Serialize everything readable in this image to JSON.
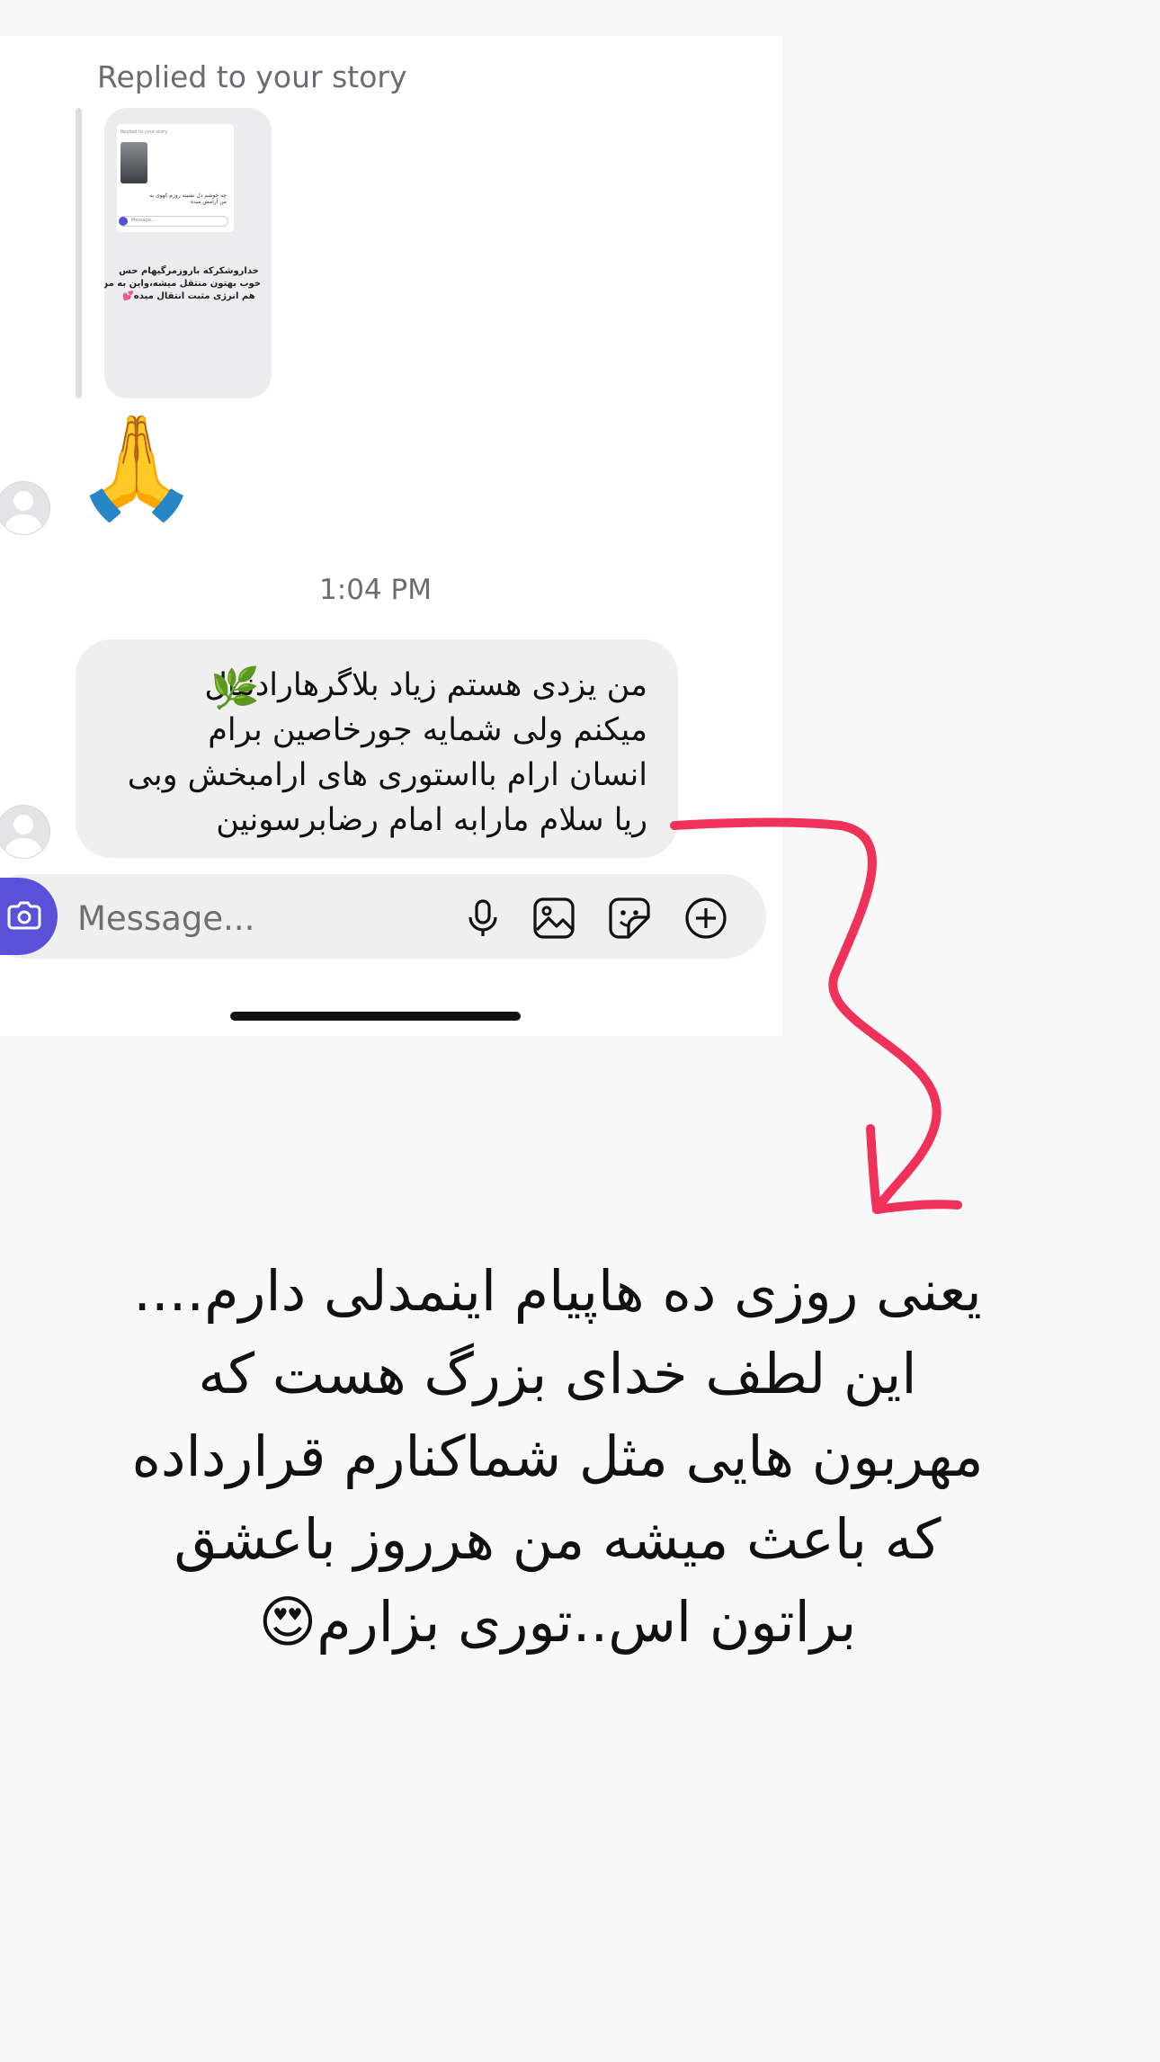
{
  "story_reply": {
    "label": "Replied to your story",
    "thumbnail": {
      "inner_label": "Replied to your story",
      "inner_message_placeholder": "Message...",
      "inner_caption_lines": [
        "چه خوشم دل نشینه روزم کهوی به",
        "من آرامش میده"
      ],
      "text_lines": [
        "خداروشکرکه باروزمرگیهام حس",
        "خوب بهتون منتقل میشه،واین به من",
        "هم انرژی مثبت انتقال میده💕"
      ]
    },
    "reaction_emoji": "🙏"
  },
  "timestamp": "1:04 PM",
  "message": {
    "leaf_emoji": "🌿",
    "lines": [
      "من یزدی هستم  زیاد بلاگرهارادنبال",
      "میکنم ولی شمایه جورخاصین برام",
      "انسان ارام بااستوری های ارامبخش وبی",
      "ریا سلام مارابه امام رضابرسونین"
    ]
  },
  "composer": {
    "placeholder": "Message...",
    "icons": [
      "camera-icon",
      "microphone-icon",
      "gallery-icon",
      "sticker-icon",
      "plus-circle-icon"
    ]
  },
  "annotation": {
    "arrow_color": "#f0315a"
  },
  "caption": {
    "lines": [
      "یعنی روزی ده هاپیام اینمدلی دارم....",
      "این لطف خدای بزرگ هست که",
      "مهربون هایی مثل شماکنارم قرارداده",
      "که باعث میشه من هرروز باعشق",
      "براتون اس..توری بزارم😍"
    ]
  },
  "colors": {
    "accent": "#5b51d8",
    "bubble": "#efeff0",
    "arrow": "#f0315a",
    "background": "#f8f8f9"
  }
}
